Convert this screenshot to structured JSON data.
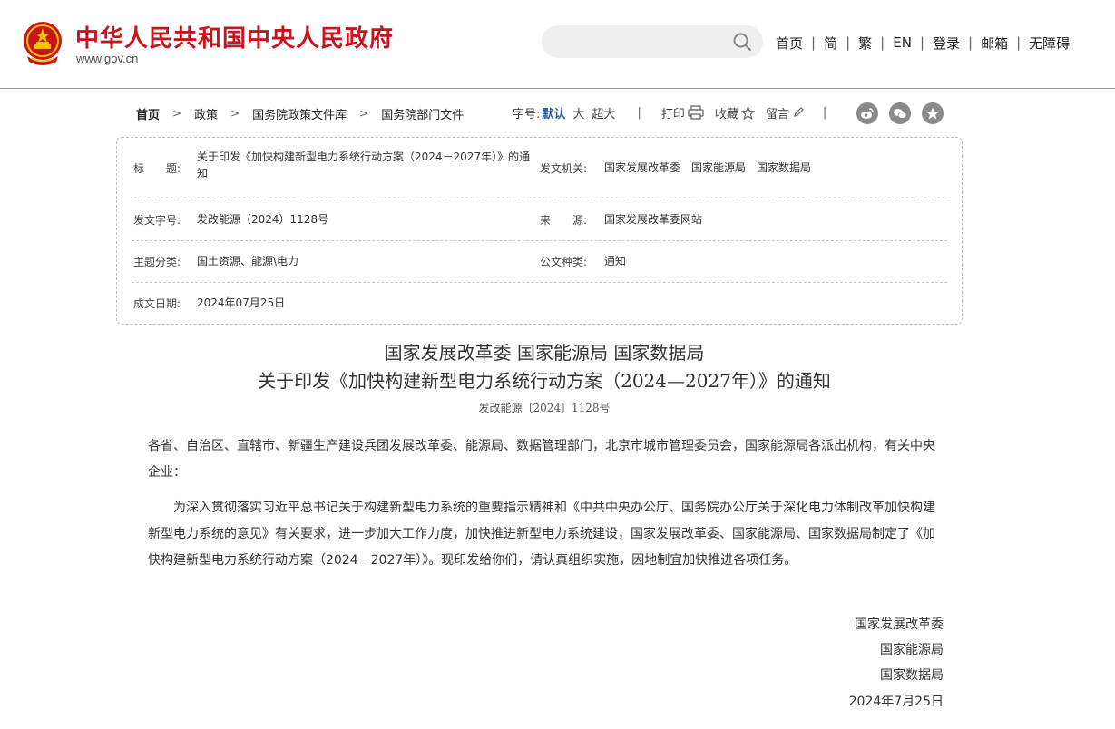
{
  "header": {
    "site_title": "中华人民共和国中央人民政府",
    "site_url": "www.gov.cn",
    "search_placeholder": "",
    "nav": [
      "首页",
      "简",
      "繁",
      "EN",
      "登录",
      "邮箱",
      "无障碍"
    ],
    "nav_sep": "|",
    "emblem_color": "#c8141c"
  },
  "breadcrumb": {
    "items": [
      "首页",
      "政策",
      "国务院政策文件库",
      "国务院部门文件"
    ],
    "arrow": ">"
  },
  "tools": {
    "font_size_label": "字号:",
    "sizes": [
      "默认",
      "大",
      "超大"
    ],
    "vbar": "|",
    "print": "打印",
    "favorite": "收藏",
    "comment": "留言"
  },
  "share_icons": [
    "weibo-icon",
    "wechat-icon",
    "star-icon"
  ],
  "info": {
    "title_label": "标　　题:",
    "title_value": "关于印发《加快构建新型电力系统行动方案（2024－2027年）》的通知",
    "issuer_label": "发文机关:",
    "issuer_value": "国家发展改革委　国家能源局　国家数据局",
    "docno_label": "发文字号:",
    "docno_value": "发改能源（2024）1128号",
    "source_label": "来　　源:",
    "source_value": "国家发展改革委网站",
    "topic_label": "主题分类:",
    "topic_value": "国土资源、能源\\电力",
    "type_label": "公文种类:",
    "type_value": "通知",
    "date_label": "成文日期:",
    "date_value": "2024年07月25日"
  },
  "article": {
    "title_line1": "国家发展改革委 国家能源局 国家数据局",
    "title_line2": "关于印发《加快构建新型电力系统行动方案（2024—2027年）》的通知",
    "doc_no": "发改能源〔2024〕1128号",
    "salutation": "各省、自治区、直辖市、新疆生产建设兵团发展改革委、能源局、数据管理部门，北京市城市管理委员会，国家能源局各派出机构，有关中央企业：",
    "body": "为深入贯彻落实习近平总书记关于构建新型电力系统的重要指示精神和《中共中央办公厅、国务院办公厅关于深化电力体制改革加快构建新型电力系统的意见》有关要求，进一步加大工作力度，加快推进新型电力系统建设，国家发展改革委、国家能源局、国家数据局制定了《加快构建新型电力系统行动方案（2024－2027年）》。现印发给你们，请认真组织实施，因地制宜加快推进各项任务。",
    "signers": [
      "国家发展改革委",
      "国家能源局",
      "国家数据局"
    ],
    "sign_date": "2024年7月25日"
  }
}
